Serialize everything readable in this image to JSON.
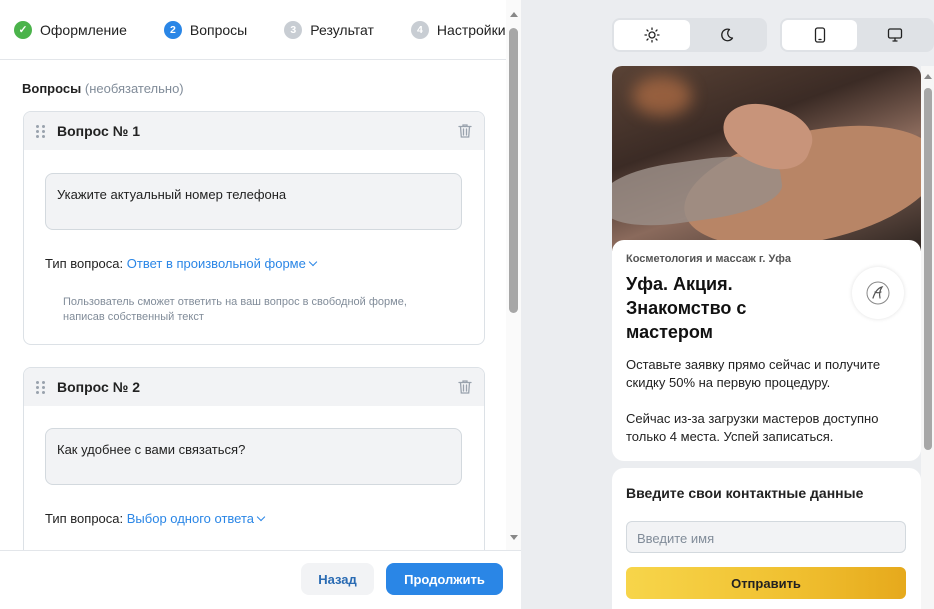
{
  "steps": [
    {
      "label": "Оформление",
      "marker": "✓",
      "state": "done"
    },
    {
      "label": "Вопросы",
      "marker": "2",
      "state": "active"
    },
    {
      "label": "Результат",
      "marker": "3",
      "state": "idle"
    },
    {
      "label": "Настройки",
      "marker": "4",
      "state": "idle"
    }
  ],
  "questions_section": {
    "title": "Вопросы",
    "optional": "(необязательно)"
  },
  "questions": [
    {
      "title": "Вопрос № 1",
      "text": "Укажите актуальный номер телефона",
      "type_label": "Тип вопроса:",
      "type_value": "Ответ в произвольной форме",
      "hint": "Пользователь сможет ответить на ваш вопрос в свободной форме, написав собственный текст"
    },
    {
      "title": "Вопрос № 2",
      "text": "Как удобнее с вами связаться?",
      "type_label": "Тип вопроса:",
      "type_value": "Выбор одного ответа"
    }
  ],
  "footer": {
    "back_label": "Назад",
    "next_label": "Продолжить"
  },
  "preview_controls": {
    "theme_options": [
      {
        "icon": "sun-icon",
        "selected": true
      },
      {
        "icon": "moon-icon",
        "selected": false
      }
    ],
    "device_options": [
      {
        "icon": "phone-icon",
        "selected": true
      },
      {
        "icon": "desktop-icon",
        "selected": false
      }
    ]
  },
  "preview": {
    "company": "Косметология и массаж г. Уфа",
    "headline": "Уфа. Акция. Знакомство с мастером",
    "description": "Оставьте заявку прямо сейчас и получите скидку 50% на первую процедуру.\n\nСейчас из-за загрузки мастеров доступно только 4 места. Успей записаться.",
    "form_title": "Введите свои контактные данные",
    "name_placeholder": "Введите имя",
    "submit_label": "Отправить"
  },
  "colors": {
    "accent": "#2a86e6",
    "done": "#4bb34b",
    "submit": "#f0c030"
  }
}
